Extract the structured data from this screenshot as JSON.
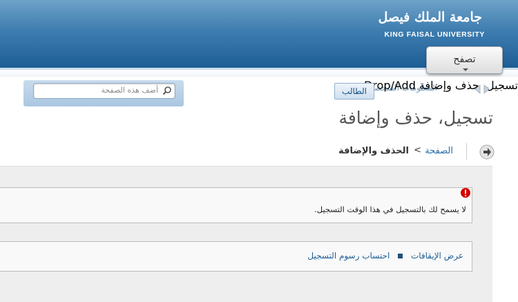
{
  "header": {
    "title_ar": "جامعة الملك فيصل",
    "title_en": "KING FAISAL UNIVERSITY",
    "browse_tab_label": "تصفح"
  },
  "search": {
    "placeholder": "أضف هذه الصفحة"
  },
  "context": {
    "faded_text": "المعلومات الشخصية",
    "overlay_text": "تسجيل، حذف وإضافة Drop/Add",
    "role_button": "الطالب"
  },
  "page": {
    "title": "تسجيل، حذف وإضافة"
  },
  "breadcrumb": {
    "home": "الصفحة",
    "separator": ">",
    "current": "الحذف والإضافة"
  },
  "error": {
    "message": "لا يسمح لك بالتسجيل في هذا الوقت التسجيل."
  },
  "links": {
    "view_holds": "عرض الإيقافات",
    "calc_fees": "احتساب رسوم التسجيل"
  },
  "colors": {
    "header_top": "#6ea2c8",
    "header_bottom": "#1d5e96",
    "link": "#1f5f96",
    "error": "#cc0000"
  }
}
